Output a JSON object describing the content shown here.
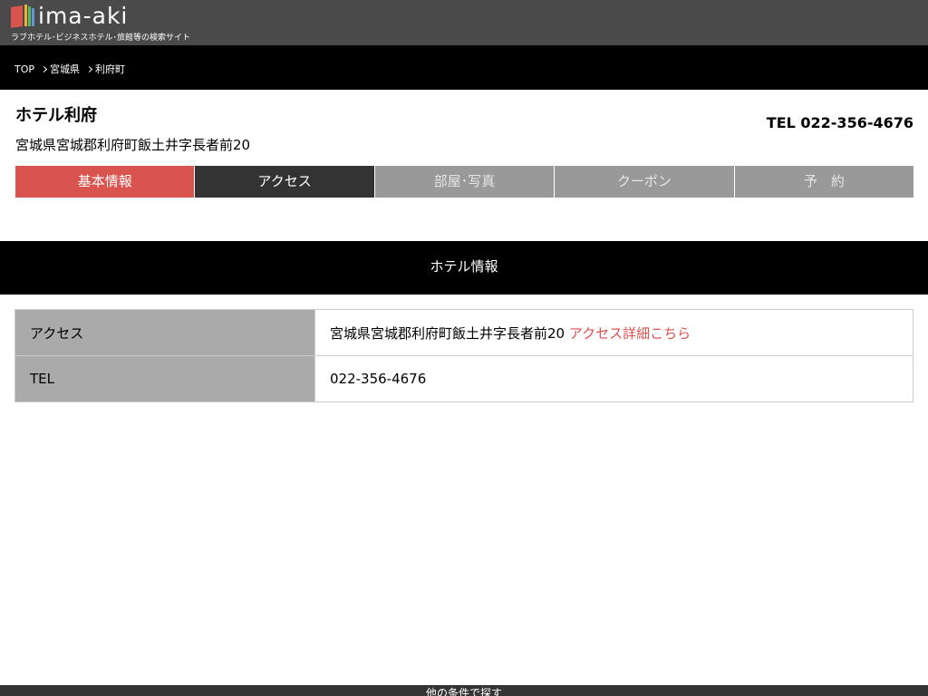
{
  "header": {
    "logo_text": "ima-aki",
    "tagline": "ラブホテル･ビジネスホテル･旅館等の検索サイト"
  },
  "breadcrumb": {
    "items": [
      "TOP",
      "宮城県",
      "利府町"
    ]
  },
  "hotel": {
    "name": "ホテル利府",
    "tel": "TEL 022-356-4676",
    "address": "宮城県宮城郡利府町飯土井字長者前20"
  },
  "tabs": [
    {
      "label": "基本情報"
    },
    {
      "label": "アクセス"
    },
    {
      "label": "部屋･写真"
    },
    {
      "label": "クーポン"
    },
    {
      "label": "予　約"
    }
  ],
  "section": {
    "title": "ホテル情報"
  },
  "info_table": {
    "rows": [
      {
        "key": "アクセス",
        "value": "宮城県宮城郡利府町飯土井字長者前20",
        "link": "アクセス詳細こちら"
      },
      {
        "key": "TEL",
        "value": "022-356-4676"
      }
    ]
  },
  "footer": {
    "label": "他の条件で探す"
  },
  "colors": {
    "header_bg": "#4a4a4a",
    "accent_red": "#d9534f",
    "tab_active_dark": "#333333",
    "tab_disabled": "#999999",
    "table_key_bg": "#aaaaaa"
  }
}
